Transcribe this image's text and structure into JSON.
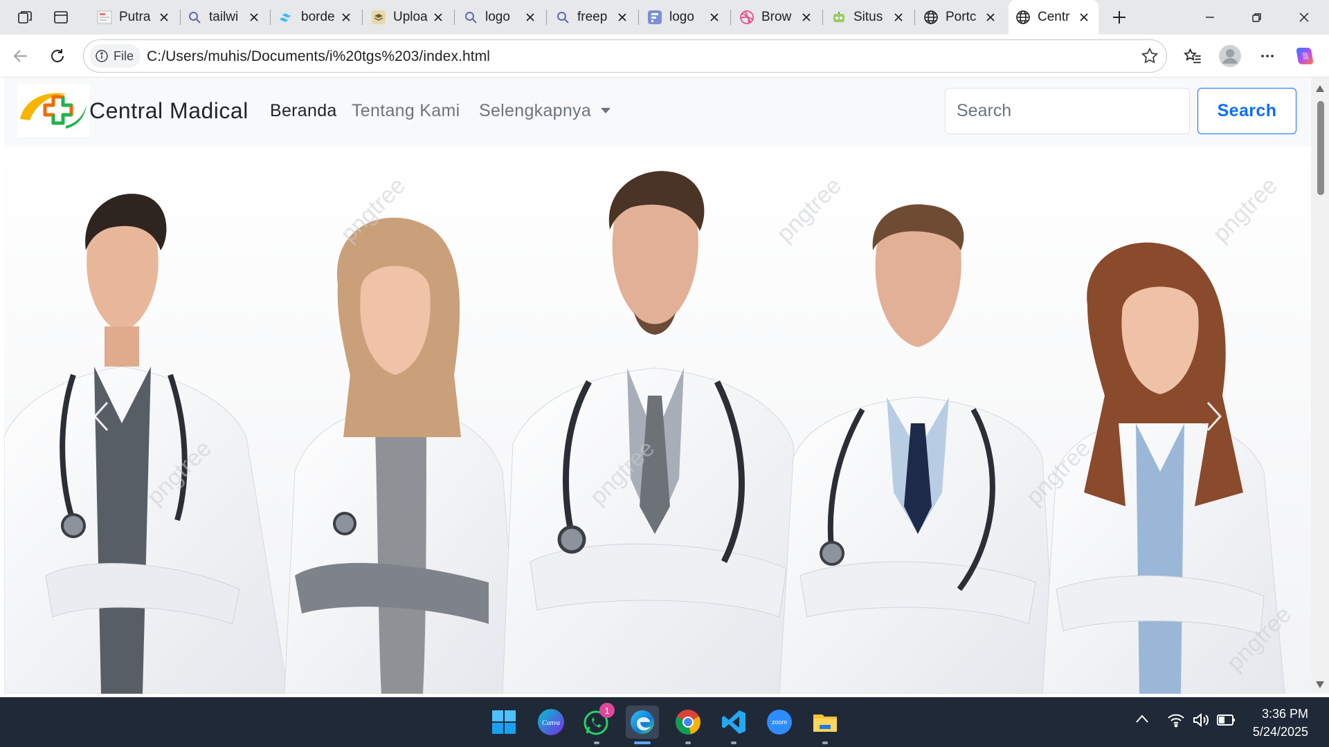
{
  "browser": {
    "tabs": [
      {
        "label": "Putra",
        "icon": "site-thumbnail-icon"
      },
      {
        "label": "tailwi",
        "icon": "search-icon"
      },
      {
        "label": "borde",
        "icon": "tailwind-icon"
      },
      {
        "label": "Uploa",
        "icon": "upload-stack-icon"
      },
      {
        "label": "logo",
        "icon": "search-icon"
      },
      {
        "label": "freep",
        "icon": "search-icon"
      },
      {
        "label": "logo",
        "icon": "forms-icon"
      },
      {
        "label": "Brow",
        "icon": "dribbble-icon"
      },
      {
        "label": "Situs",
        "icon": "robot-icon"
      },
      {
        "label": "Portc",
        "icon": "globe-icon"
      },
      {
        "label": "Centr",
        "icon": "globe-icon",
        "active": true
      }
    ],
    "address": {
      "scheme_label": "File",
      "url": "C:/Users/muhis/Documents/i%20tgs%203/index.html"
    }
  },
  "site": {
    "brand_name": "Central Madical",
    "nav": [
      {
        "label": "Beranda",
        "active": true
      },
      {
        "label": "Tentang Kami",
        "active": false
      },
      {
        "label": "Selengkapnya",
        "dropdown": true
      }
    ],
    "search": {
      "placeholder": "Search",
      "button_label": "Search"
    },
    "hero": {
      "people_count": 5,
      "watermark": "pngtree"
    },
    "colors": {
      "primary": "#0d6efd",
      "nav_bg": "#f8f9fa",
      "logo_orange": "#f39c12",
      "logo_green": "#2ecc40"
    }
  },
  "taskbar": {
    "apps": [
      "windows-start-icon",
      "canva-icon",
      "whatsapp-icon",
      "edge-icon",
      "chrome-icon",
      "vscode-icon",
      "zoom-icon",
      "file-explorer-icon"
    ],
    "canva_label": "Canva",
    "zoom_label": "zoom",
    "whatsapp_badge": "1",
    "time": "3:36 PM",
    "date": "5/24/2025"
  }
}
